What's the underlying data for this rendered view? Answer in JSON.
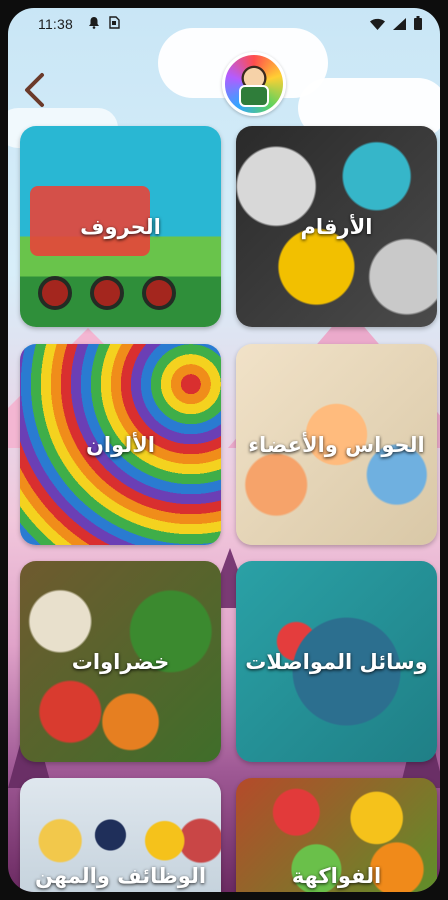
{
  "status_bar": {
    "time": "11:38",
    "left_icons": [
      "notification-bell-icon",
      "sim-icon"
    ],
    "right_icons": [
      "wifi-icon",
      "signal-icon",
      "battery-icon"
    ]
  },
  "header": {
    "back_icon": "chevron-left-icon",
    "avatar": "app-logo-avatar"
  },
  "categories": [
    {
      "label": "الأرقام"
    },
    {
      "label": "الحروف"
    },
    {
      "label": "الحواس والأعضاء"
    },
    {
      "label": "الألوان"
    },
    {
      "label": "وسائل المواصلات"
    },
    {
      "label": "خضراوات"
    },
    {
      "label": "الفواكهة"
    },
    {
      "label": "الوظائف والمهن"
    }
  ],
  "colors": {
    "sky": "#c9e6f6",
    "back_arrow": "#6b3a2a",
    "label_text": "#ffffff"
  }
}
